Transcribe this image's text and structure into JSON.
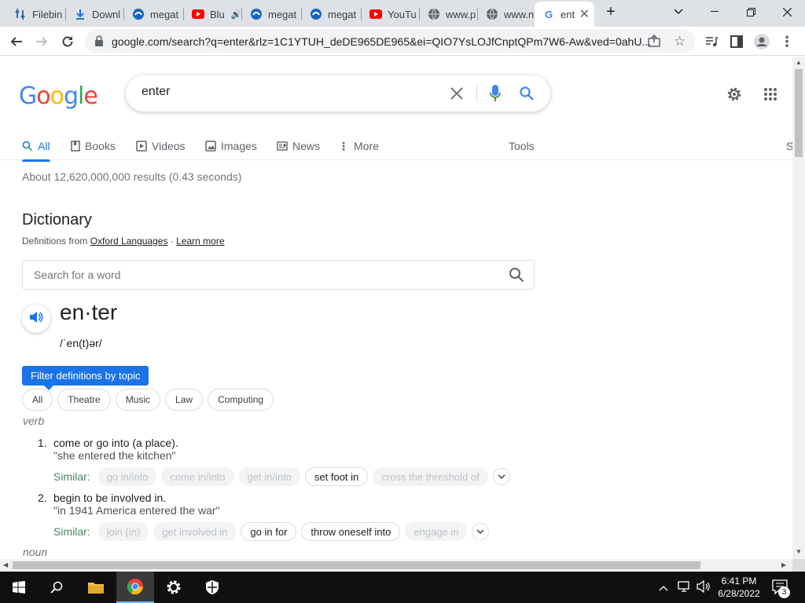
{
  "browser": {
    "tabs": [
      {
        "label": "Filebin",
        "icon": "filebin-icon"
      },
      {
        "label": "Downl",
        "icon": "download-icon"
      },
      {
        "label": "megat",
        "icon": "mega-icon"
      },
      {
        "label": "Blu",
        "icon": "youtube-icon"
      },
      {
        "label": "megat",
        "icon": "mega-icon"
      },
      {
        "label": "megat",
        "icon": "mega-icon"
      },
      {
        "label": "YouTu",
        "icon": "youtube-icon"
      },
      {
        "label": "www.p",
        "icon": "globe-icon"
      },
      {
        "label": "www.n",
        "icon": "globe-icon"
      },
      {
        "label": "ent",
        "icon": "google-icon",
        "active": true
      }
    ],
    "url": "google.com/search?q=enter&rlz=1C1YTUH_deDE965DE965&ei=QIO7YsLOJfCnptQPm7W6-Aw&ved=0ahU..."
  },
  "search": {
    "logo_text": "Google",
    "query": "enter",
    "tabs": [
      {
        "label": "All",
        "active": true
      },
      {
        "label": "Books"
      },
      {
        "label": "Videos"
      },
      {
        "label": "Images"
      },
      {
        "label": "News"
      },
      {
        "label": "More"
      }
    ],
    "tools_label": "Tools",
    "cut_label": "S",
    "stats": "About 12,620,000,000 results (0.43 seconds)"
  },
  "dictionary": {
    "title": "Dictionary",
    "from_prefix": "Definitions from",
    "source": "Oxford Languages",
    "separator": "·",
    "learn_more": "Learn more",
    "search_placeholder": "Search for a word",
    "headword": "en·ter",
    "phonetic": "/ˈen(t)ər/",
    "filter_label": "Filter definitions by topic",
    "topics": [
      "All",
      "Theatre",
      "Music",
      "Law",
      "Computing"
    ],
    "part_of_speech": "verb",
    "similar_label": "Similar:",
    "definitions": [
      {
        "number": "1.",
        "text": "come or go into (a place).",
        "example": "\"she entered the kitchen\"",
        "similar": [
          {
            "word": "go in/into",
            "linked": false
          },
          {
            "word": "come in/into",
            "linked": false
          },
          {
            "word": "get in/into",
            "linked": false
          },
          {
            "word": "set foot in",
            "linked": true
          },
          {
            "word": "cross the threshold of",
            "linked": false
          }
        ]
      },
      {
        "number": "2.",
        "text": "begin to be involved in.",
        "example": "\"in 1941 America entered the war\"",
        "similar": [
          {
            "word": "join (in)",
            "linked": false
          },
          {
            "word": "get involved in",
            "linked": false
          },
          {
            "word": "go in for",
            "linked": true
          },
          {
            "word": "throw oneself into",
            "linked": true
          },
          {
            "word": "engage in",
            "linked": false
          }
        ]
      }
    ],
    "next_pos": "noun"
  },
  "taskbar": {
    "time": "6:41 PM",
    "date": "6/28/2022",
    "notifications": "3"
  },
  "colors": {
    "accent": "#1a73e8",
    "tab_strip": "#dee1e6",
    "taskbar": "#101010"
  }
}
